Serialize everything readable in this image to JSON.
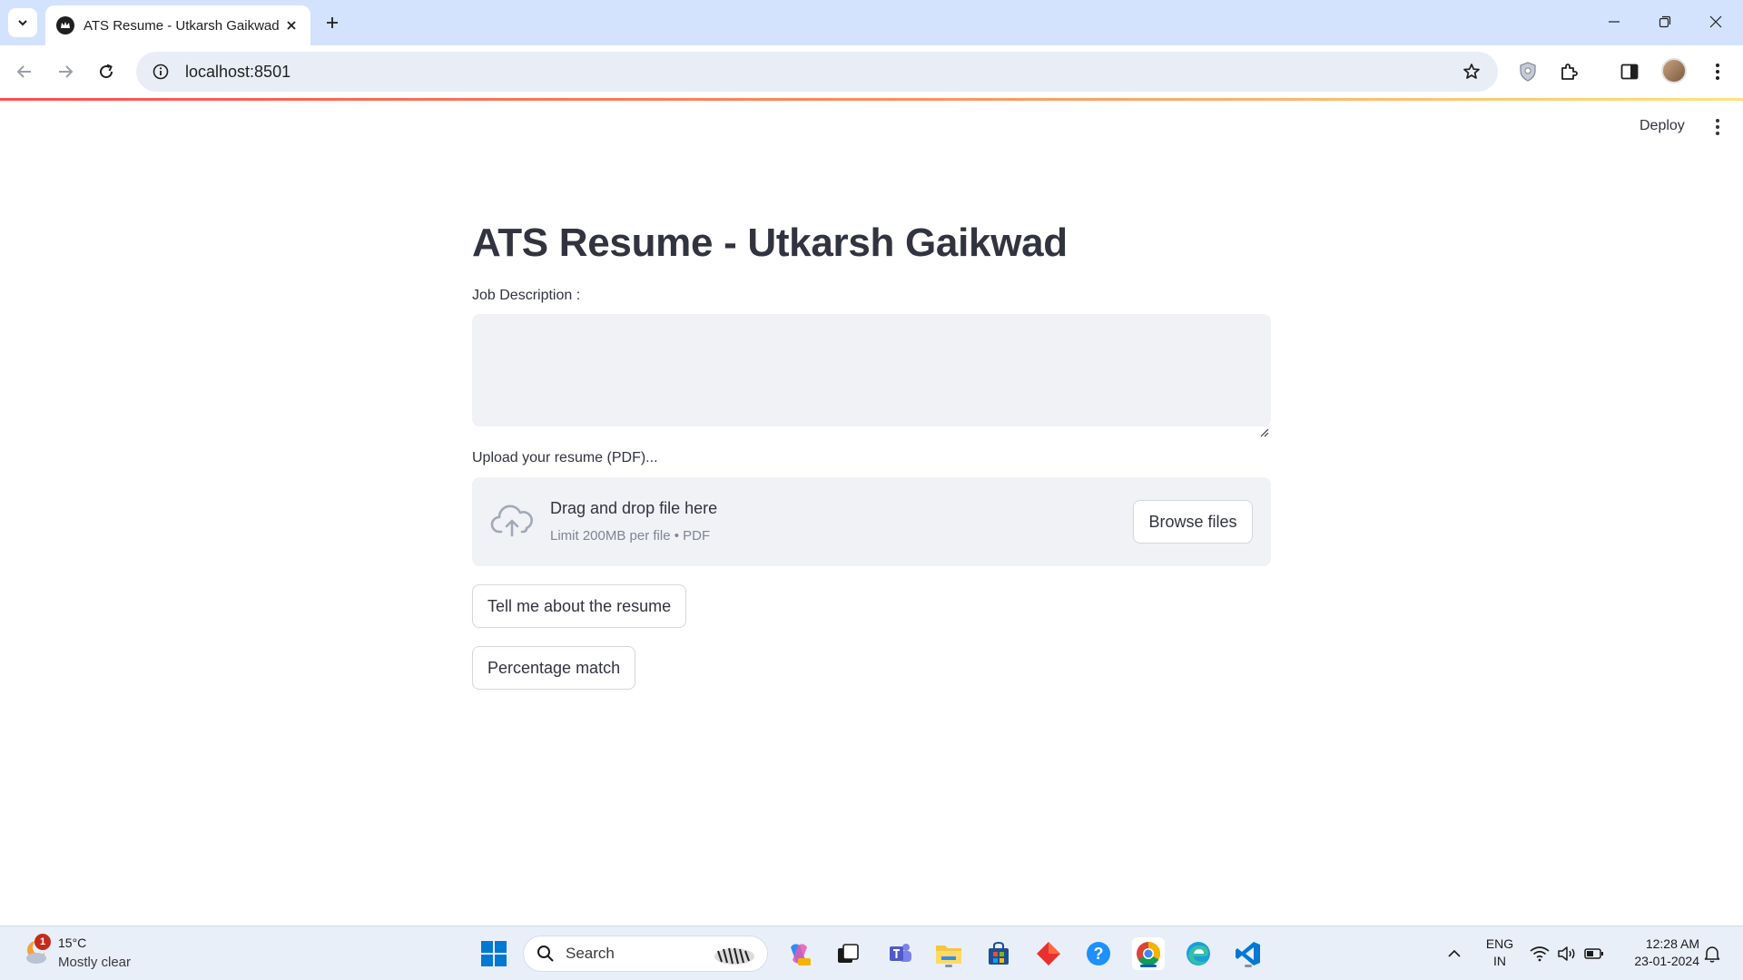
{
  "browser": {
    "tab_title": "ATS Resume - Utkarsh Gaikwad",
    "url": "localhost:8501"
  },
  "app": {
    "deploy_label": "Deploy",
    "title": "ATS Resume - Utkarsh Gaikwad",
    "job_description_label": "Job Description :",
    "job_description_value": "",
    "upload_label": "Upload your resume (PDF)...",
    "dropzone_title": "Drag and drop file here",
    "dropzone_limit": "Limit 200MB per file • PDF",
    "browse_label": "Browse files",
    "button_tell_me": "Tell me about the resume",
    "button_percentage": "Percentage match",
    "accent_color": "#ff4b4b"
  },
  "taskbar": {
    "weather_badge": "1",
    "weather_temp": "15°C",
    "weather_condition": "Mostly clear",
    "search_placeholder": "Search",
    "lang_line1": "ENG",
    "lang_line2": "IN",
    "time": "12:28 AM",
    "date": "23-01-2024"
  }
}
